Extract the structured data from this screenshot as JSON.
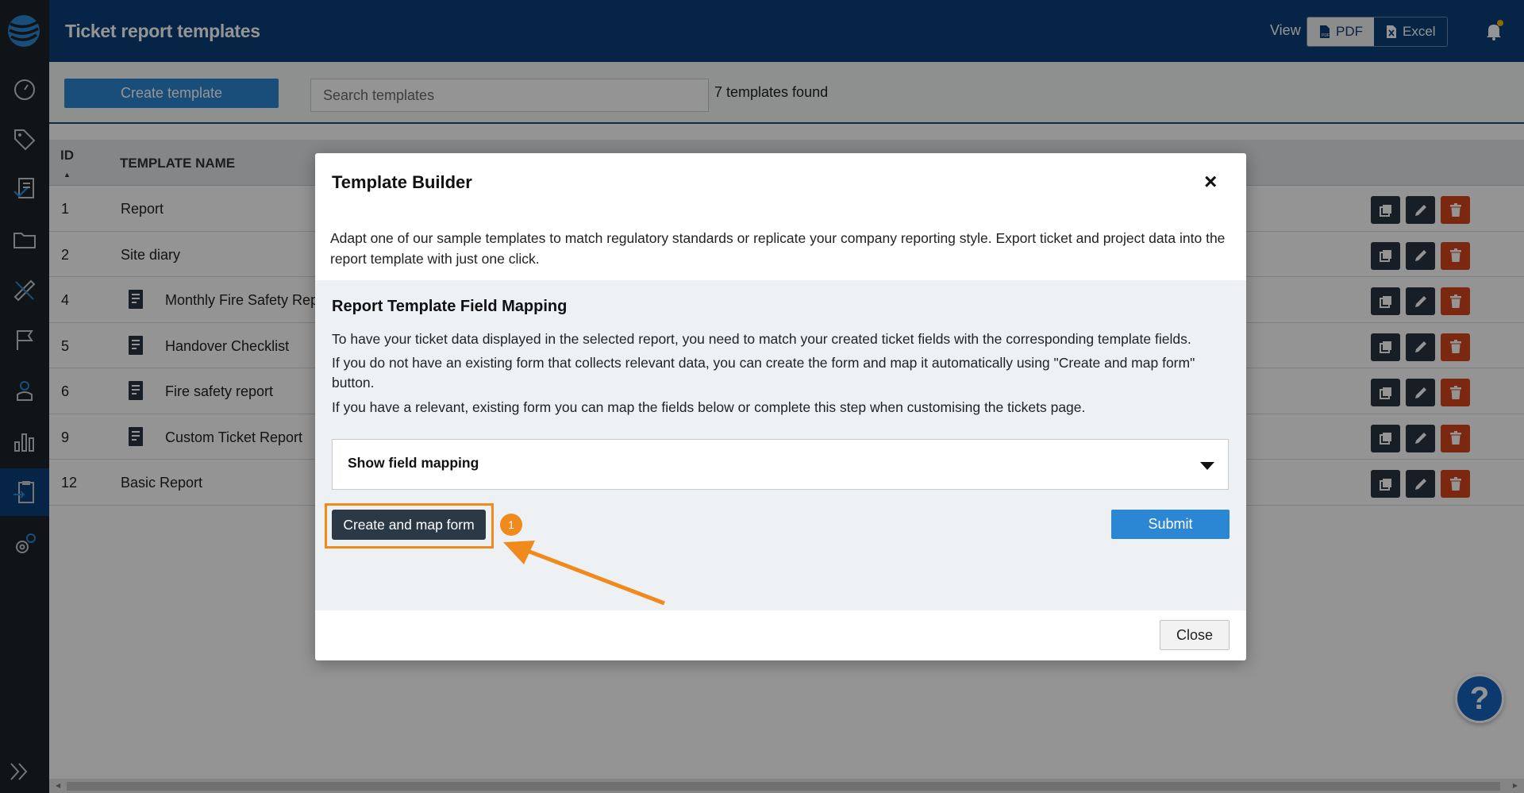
{
  "header": {
    "title": "Ticket report templates",
    "view_label": "View",
    "pdf_label": "PDF",
    "excel_label": "Excel"
  },
  "toolbar": {
    "create_label": "Create template",
    "search_placeholder": "Search templates",
    "found_text": "7 templates found"
  },
  "table": {
    "headers": {
      "id": "ID",
      "name": "TEMPLATE NAME"
    },
    "rows": [
      {
        "id": "1",
        "name": "Report"
      },
      {
        "id": "2",
        "name": "Site diary"
      },
      {
        "id": "4",
        "name": "Monthly Fire Safety Rep"
      },
      {
        "id": "5",
        "name": "Handover Checklist"
      },
      {
        "id": "6",
        "name": "Fire safety report"
      },
      {
        "id": "9",
        "name": "Custom Ticket Report"
      },
      {
        "id": "12",
        "name": "Basic Report"
      }
    ]
  },
  "modal": {
    "title": "Template Builder",
    "close_x": "×",
    "description": "Adapt one of our sample templates to match regulatory standards or replicate your company reporting style. Export ticket and project data into the report template with just one click.",
    "section_title": "Report Template Field Mapping",
    "para1": "To have your ticket data displayed in the selected report, you need to match your created ticket fields with the corresponding template fields.",
    "para2": "If you do not have an existing form that collects relevant data, you can create the form and map it automatically using \"Create and map form\" button.",
    "para3": "If you have a relevant, existing form you can map the fields below or complete this step when customising the tickets page.",
    "mapping_label": "Show field mapping",
    "create_map_label": "Create and map form",
    "step_number": "1",
    "submit_label": "Submit",
    "close_label": "Close"
  },
  "help_label": "?",
  "colors": {
    "header": "#0c3f79",
    "sidebar": "#1d2329",
    "primary": "#2b86d3",
    "danger": "#d6441a",
    "highlight": "#f08a1c"
  }
}
